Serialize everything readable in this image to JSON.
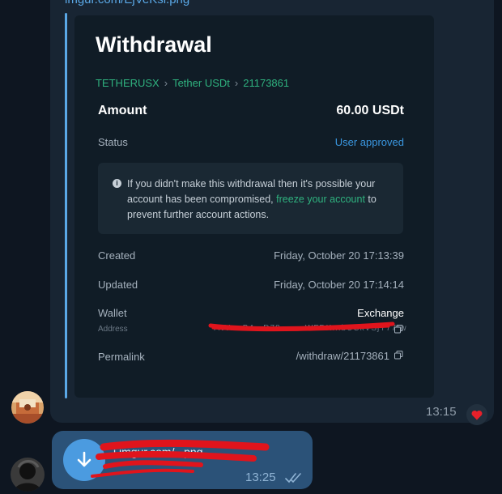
{
  "message_in": {
    "link_text": "imgur.com/EjVeKsi.png",
    "time": "13:15",
    "reaction": "heart-icon"
  },
  "card": {
    "title": "Withdrawal",
    "breadcrumb": [
      "TETHERUSX",
      "Tether USDt",
      "21173861"
    ],
    "amount_label": "Amount",
    "amount_value": "60.00 USDt",
    "status_label": "Status",
    "status_value": "User approved",
    "notice_prefix": "If you didn't make this withdrawal then it's possible your account has been compromised, ",
    "notice_link": "freeze your account",
    "notice_suffix": " to prevent further account actions.",
    "created_label": "Created",
    "created_value": "Friday, October 20 17:13:39",
    "updated_label": "Updated",
    "updated_value": "Friday, October 20 17:14:14",
    "wallet_label": "Wallet",
    "wallet_value": "Exchange",
    "address_label": "Address",
    "address_value": "TNVr...B4...D78........WFDK...bUCkVSjY77rw",
    "permalink_label": "Permalink",
    "permalink_value": "/withdraw/21173861"
  },
  "message_out": {
    "file_name": "i.imgur.com/...png",
    "time": "13:25",
    "status": "read"
  },
  "colors": {
    "background": "#0e1621",
    "bubble_in": "#182533",
    "bubble_out": "#2b5278",
    "accent_green": "#2fb27f",
    "accent_blue": "#3a97e0",
    "redaction": "#e0141c"
  }
}
